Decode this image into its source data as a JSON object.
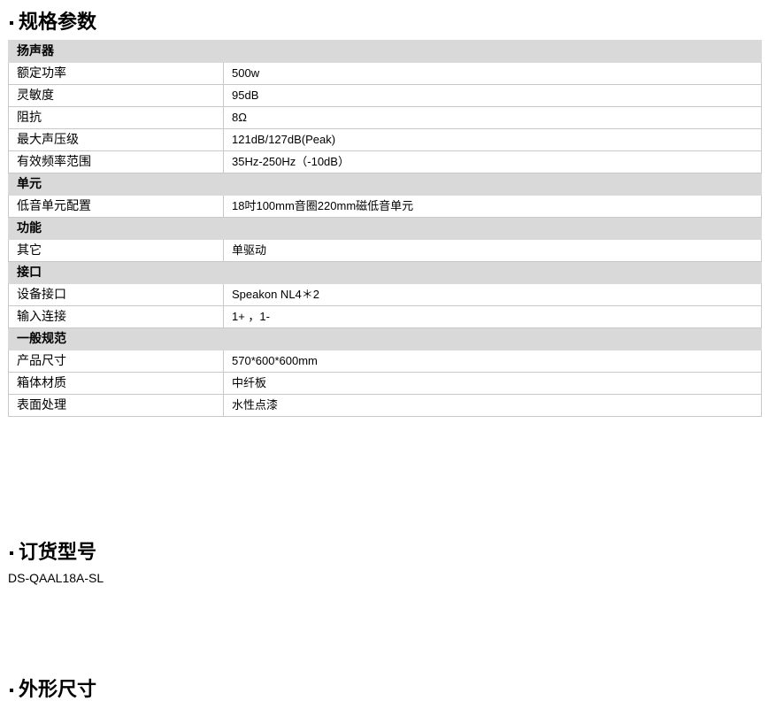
{
  "sections": {
    "specs_title": "规格参数",
    "order_title": "订货型号",
    "dims_title": "外形尺寸"
  },
  "spec_table": [
    {
      "group": "扬声器",
      "rows": [
        {
          "label": "额定功率",
          "value": "500w"
        },
        {
          "label": "灵敏度",
          "value": "95dB"
        },
        {
          "label": "阻抗",
          "value": "8Ω"
        },
        {
          "label": "最大声压级",
          "value": "121dB/127dB(Peak)"
        },
        {
          "label": "有效频率范围",
          "value": "35Hz-250Hz（-10dB）"
        }
      ]
    },
    {
      "group": "单元",
      "rows": [
        {
          "label": "低音单元配置",
          "value": "18吋100mm音圈220mm磁低音单元"
        }
      ]
    },
    {
      "group": "功能",
      "rows": [
        {
          "label": "其它",
          "value": "单驱动"
        }
      ]
    },
    {
      "group": "接口",
      "rows": [
        {
          "label": "设备接口",
          "value": "Speakon NL4＊2"
        },
        {
          "label": "输入连接",
          "value": "1+ ，1-"
        }
      ]
    },
    {
      "group": "一般规范",
      "rows": [
        {
          "label": "产品尺寸",
          "value": "570*600*600mm"
        },
        {
          "label": "箱体材质",
          "value": "中纤板"
        },
        {
          "label": "表面处理",
          "value": "水性点漆"
        }
      ]
    }
  ],
  "order": {
    "model": "DS-QAAL18A-SL"
  }
}
